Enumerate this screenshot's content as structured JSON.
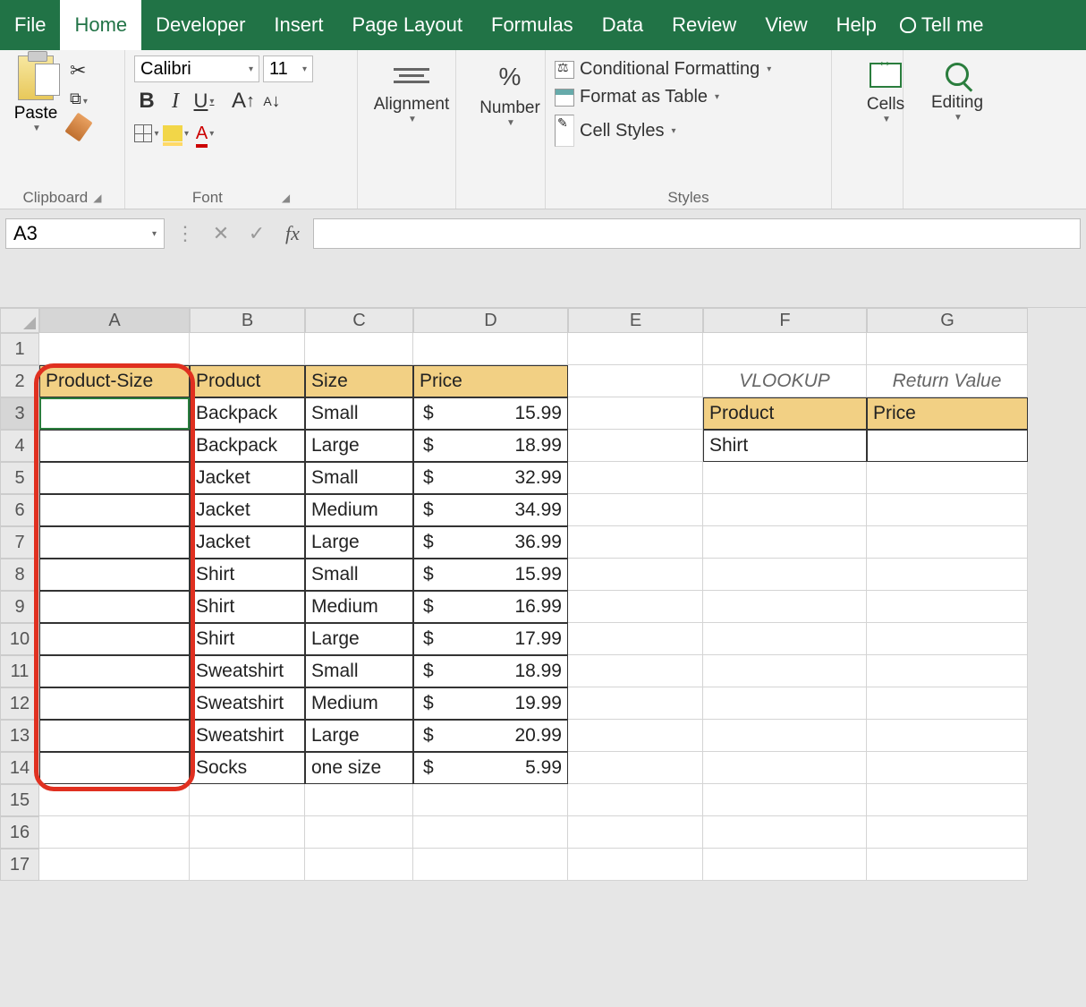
{
  "tabs": [
    "File",
    "Home",
    "Developer",
    "Insert",
    "Page Layout",
    "Formulas",
    "Data",
    "Review",
    "View",
    "Help"
  ],
  "active_tab": "Home",
  "tell_me": "Tell me",
  "groups": {
    "clipboard": {
      "label": "Clipboard",
      "paste": "Paste"
    },
    "font": {
      "label": "Font",
      "name": "Calibri",
      "size": "11"
    },
    "alignment": {
      "label": "Alignment"
    },
    "number": {
      "label": "Number"
    },
    "styles": {
      "label": "Styles",
      "items": [
        "Conditional Formatting",
        "Format as Table",
        "Cell Styles"
      ]
    },
    "cells": {
      "label": "Cells"
    },
    "editing": {
      "label": "Editing"
    }
  },
  "name_box": "A3",
  "formula": "",
  "columns": [
    "A",
    "B",
    "C",
    "D",
    "E",
    "F",
    "G"
  ],
  "headers1": {
    "a": "Product-Size",
    "b": "Product",
    "c": "Size",
    "d": "Price"
  },
  "lookup_labels": {
    "f": "VLOOKUP",
    "g": "Return Value"
  },
  "headers2": {
    "f": "Product",
    "g": "Price"
  },
  "lookup_row": {
    "f": "Shirt",
    "g": ""
  },
  "rows": [
    {
      "b": "Backpack",
      "c": "Small",
      "p": "15.99"
    },
    {
      "b": "Backpack",
      "c": "Large",
      "p": "18.99"
    },
    {
      "b": "Jacket",
      "c": "Small",
      "p": "32.99"
    },
    {
      "b": "Jacket",
      "c": "Medium",
      "p": "34.99"
    },
    {
      "b": "Jacket",
      "c": "Large",
      "p": "36.99"
    },
    {
      "b": "Shirt",
      "c": "Small",
      "p": "15.99"
    },
    {
      "b": "Shirt",
      "c": "Medium",
      "p": "16.99"
    },
    {
      "b": "Shirt",
      "c": "Large",
      "p": "17.99"
    },
    {
      "b": "Sweatshirt",
      "c": "Small",
      "p": "18.99"
    },
    {
      "b": "Sweatshirt",
      "c": "Medium",
      "p": "19.99"
    },
    {
      "b": "Sweatshirt",
      "c": "Large",
      "p": "20.99"
    },
    {
      "b": "Socks",
      "c": "one size",
      "p": "5.99"
    }
  ],
  "currency": "$",
  "chart_data": {
    "type": "table",
    "columns": [
      "Product-Size",
      "Product",
      "Size",
      "Price"
    ],
    "rows": [
      [
        "",
        "Backpack",
        "Small",
        15.99
      ],
      [
        "",
        "Backpack",
        "Large",
        18.99
      ],
      [
        "",
        "Jacket",
        "Small",
        32.99
      ],
      [
        "",
        "Jacket",
        "Medium",
        34.99
      ],
      [
        "",
        "Jacket",
        "Large",
        36.99
      ],
      [
        "",
        "Shirt",
        "Small",
        15.99
      ],
      [
        "",
        "Shirt",
        "Medium",
        16.99
      ],
      [
        "",
        "Shirt",
        "Large",
        17.99
      ],
      [
        "",
        "Sweatshirt",
        "Small",
        18.99
      ],
      [
        "",
        "Sweatshirt",
        "Medium",
        19.99
      ],
      [
        "",
        "Sweatshirt",
        "Large",
        20.99
      ],
      [
        "",
        "Socks",
        "one size",
        5.99
      ]
    ],
    "lookup": {
      "VLOOKUP": "Product",
      "Return Value": "Price",
      "key": "Shirt"
    }
  }
}
